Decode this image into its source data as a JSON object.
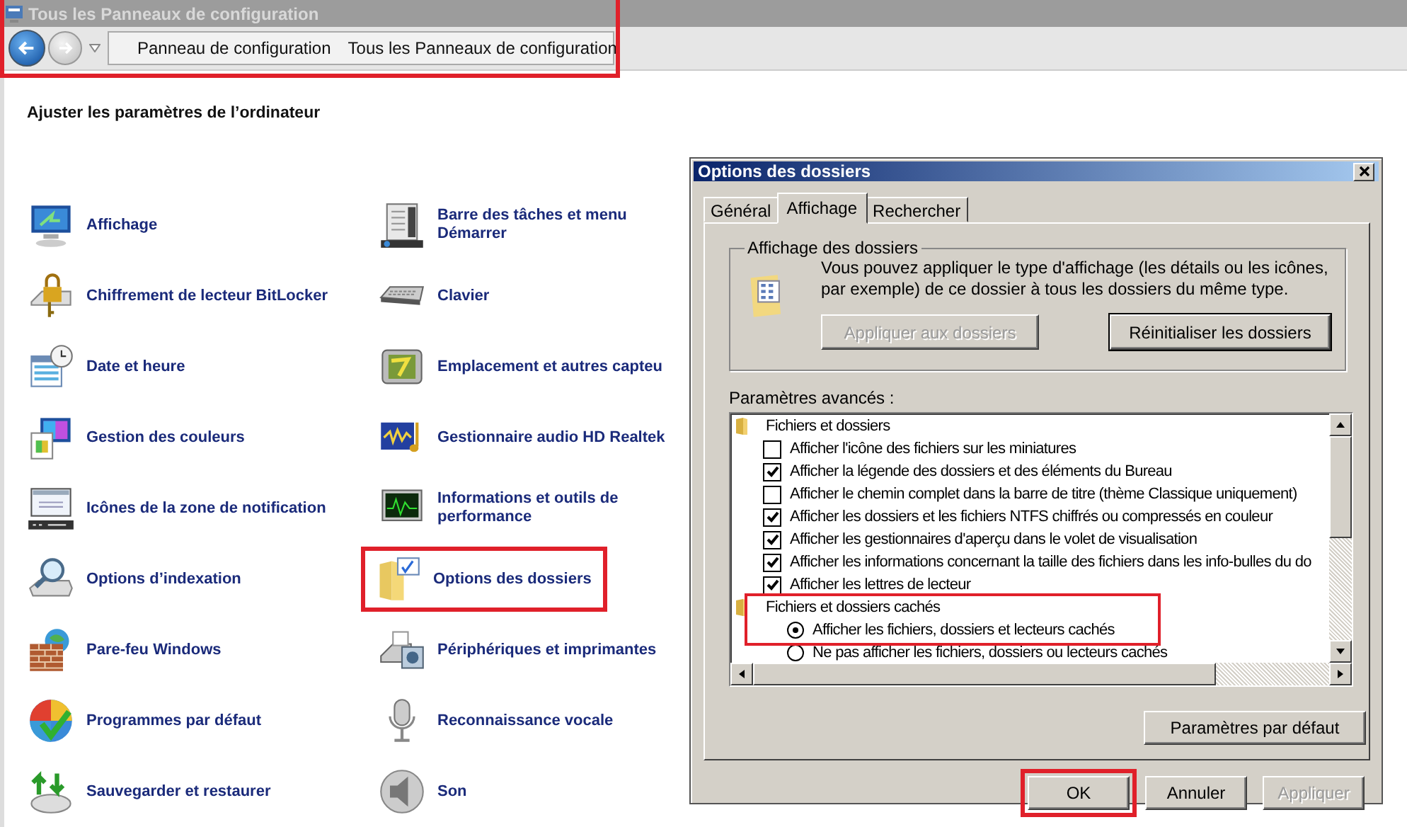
{
  "window": {
    "title": "Tous les Panneaux de configuration"
  },
  "address_bar": {
    "highlighted": true,
    "breadcrumbs": [
      "Panneau de configuration",
      "Tous les Panneaux de configuration"
    ]
  },
  "heading": "Ajuster les paramètres de l’ordinateur",
  "items": [
    {
      "label": "Affichage",
      "highlighted": false
    },
    {
      "label": "Chiffrement de lecteur BitLocker",
      "highlighted": false
    },
    {
      "label": "Date et heure",
      "highlighted": false
    },
    {
      "label": "Gestion des couleurs",
      "highlighted": false
    },
    {
      "label": "Icônes de la zone de notification",
      "highlighted": false
    },
    {
      "label": "Options d’indexation",
      "highlighted": false
    },
    {
      "label": "Pare-feu Windows",
      "highlighted": false
    },
    {
      "label": "Programmes par défaut",
      "highlighted": false
    },
    {
      "label": "Sauvegarder et restaurer",
      "highlighted": false
    },
    {
      "label": "Barre des tâches et menu Démarrer",
      "highlighted": false
    },
    {
      "label": "Clavier",
      "highlighted": false
    },
    {
      "label": "Emplacement et autres capteu",
      "highlighted": false
    },
    {
      "label": "Gestionnaire audio HD Realtek",
      "highlighted": false
    },
    {
      "label": "Informations et outils de performance",
      "highlighted": false
    },
    {
      "label": "Options des dossiers",
      "highlighted": true
    },
    {
      "label": "Périphériques et imprimantes",
      "highlighted": false
    },
    {
      "label": "Reconnaissance vocale",
      "highlighted": false
    },
    {
      "label": "Son",
      "highlighted": false
    }
  ],
  "dialog": {
    "title": "Options des dossiers",
    "tabs": [
      {
        "label": "Général",
        "selected": false
      },
      {
        "label": "Affichage",
        "selected": true
      },
      {
        "label": "Rechercher",
        "selected": false
      }
    ],
    "folder_views": {
      "title": "Affichage des dossiers",
      "description": "Vous pouvez appliquer le type d'affichage (les détails ou les icônes, par exemple) de ce dossier à tous les dossiers du même type.",
      "buttons": [
        {
          "label": "Appliquer aux dossiers",
          "disabled": true
        },
        {
          "label": "Réinitialiser les dossiers",
          "disabled": false
        }
      ]
    },
    "advanced_label": "Paramètres avancés :",
    "tree": [
      {
        "label": "Fichiers et dossiers",
        "highlighted": false,
        "children": [
          {
            "kind": "checkbox",
            "label": "Afficher l'icône des fichiers sur les miniatures",
            "checked": false
          },
          {
            "kind": "checkbox",
            "label": "Afficher la légende des dossiers et des éléments du Bureau",
            "checked": true
          },
          {
            "kind": "checkbox",
            "label": "Afficher le chemin complet dans la barre de titre (thème Classique uniquement)",
            "checked": false
          },
          {
            "kind": "checkbox",
            "label": "Afficher les dossiers et les fichiers NTFS chiffrés ou compressés en couleur",
            "checked": true
          },
          {
            "kind": "checkbox",
            "label": "Afficher les gestionnaires d'aperçu dans le volet de visualisation",
            "checked": true
          },
          {
            "kind": "checkbox",
            "label": "Afficher les informations concernant la taille des fichiers dans les info-bulles du do",
            "checked": true
          },
          {
            "kind": "checkbox",
            "label": "Afficher les lettres de lecteur",
            "checked": true
          }
        ]
      },
      {
        "label": "Fichiers et dossiers cachés",
        "highlighted": true,
        "children": [
          {
            "kind": "radio",
            "label": "Afficher les fichiers, dossiers et lecteurs cachés",
            "selected": true
          },
          {
            "kind": "radio",
            "label": "Ne pas afficher les fichiers, dossiers ou lecteurs cachés",
            "selected": false
          }
        ]
      }
    ],
    "defaults_button": "Paramètres par défaut",
    "buttons": [
      {
        "label": "OK",
        "disabled": false,
        "highlighted": true
      },
      {
        "label": "Annuler",
        "disabled": false,
        "highlighted": false
      },
      {
        "label": "Appliquer",
        "disabled": true,
        "highlighted": false
      }
    ]
  }
}
